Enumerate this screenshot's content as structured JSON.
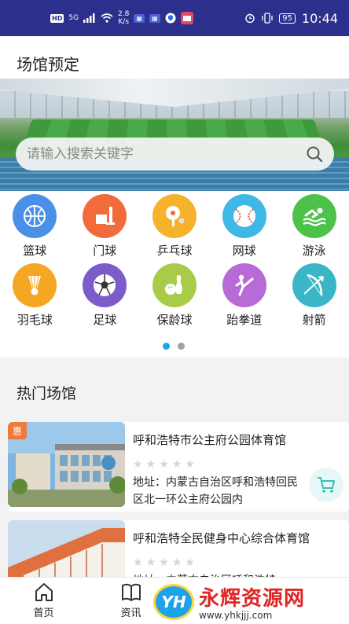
{
  "status_bar": {
    "hd": "HD",
    "network": "5G",
    "speed_top": "2.8",
    "speed_bottom": "K/s",
    "battery": "95",
    "time": "10:44"
  },
  "page": {
    "title": "场馆预定"
  },
  "search": {
    "placeholder": "请输入搜索关键字"
  },
  "categories": [
    {
      "label": "篮球",
      "icon": "basketball-icon",
      "color": "#4a90e6"
    },
    {
      "label": "门球",
      "icon": "gateball-icon",
      "color": "#f26b3a"
    },
    {
      "label": "乒乓球",
      "icon": "pingpong-icon",
      "color": "#f5b22a"
    },
    {
      "label": "网球",
      "icon": "tennis-icon",
      "color": "#3fb8e6"
    },
    {
      "label": "游泳",
      "icon": "swimming-icon",
      "color": "#4cc24a"
    },
    {
      "label": "羽毛球",
      "icon": "badminton-icon",
      "color": "#f5a623"
    },
    {
      "label": "足球",
      "icon": "football-icon",
      "color": "#7b5cc8"
    },
    {
      "label": "保龄球",
      "icon": "bowling-icon",
      "color": "#a8cc4a"
    },
    {
      "label": "跆拳道",
      "icon": "taekwondo-icon",
      "color": "#b86ad6"
    },
    {
      "label": "射箭",
      "icon": "archery-icon",
      "color": "#3bb5c8"
    }
  ],
  "pager": {
    "count": 2,
    "active": 0
  },
  "hot": {
    "title": "热门场馆",
    "venues": [
      {
        "name": "呼和浩特市公主府公园体育馆",
        "badge": "惠",
        "stars": 0,
        "address": "地址：内蒙古自治区呼和浩特回民区北一环公主府公园内"
      },
      {
        "name": "呼和浩特全民健身中心综合体育馆",
        "badge": "",
        "stars": 0,
        "address": "地址：内蒙古自治区呼和浩特"
      }
    ]
  },
  "tabbar": {
    "items": [
      {
        "label": "首页",
        "icon": "home-icon"
      },
      {
        "label": "资讯",
        "icon": "book-icon"
      }
    ]
  },
  "watermark": {
    "logo": "YH",
    "title": "永辉资源网",
    "url": "www.yhkjjj.com"
  },
  "colors": {
    "status_bar": "#2d2f8c",
    "accent": "#1aa6e8",
    "cart_bg": "#e5f7f6",
    "badge": "#f07a3a"
  }
}
